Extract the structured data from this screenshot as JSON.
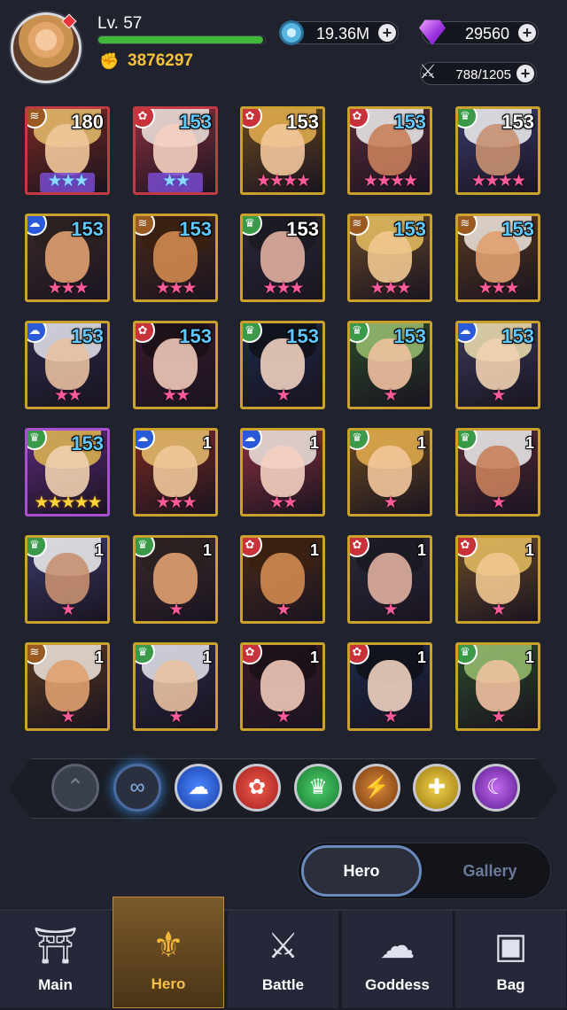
{
  "player": {
    "level_label": "Lv. 57",
    "power": "3876297",
    "xp_fraction": 0.99
  },
  "currency": {
    "coins": "19.36M",
    "gems": "29560",
    "hero_capacity": "788/1205"
  },
  "heroes": [
    {
      "level": "180",
      "stars": "★★★",
      "star_color": "blue",
      "faction": "bronze",
      "quality": "red"
    },
    {
      "level": "153",
      "stars": "★★",
      "star_color": "blue",
      "faction": "red",
      "quality": "red"
    },
    {
      "level": "153",
      "stars": "★★★★",
      "star_color": "pink",
      "faction": "red",
      "quality": "gold"
    },
    {
      "level": "153",
      "stars": "★★★★",
      "star_color": "pink",
      "faction": "red",
      "quality": "gold"
    },
    {
      "level": "153",
      "stars": "★★★★",
      "star_color": "pink",
      "faction": "nature",
      "quality": "gold"
    },
    {
      "level": "153",
      "stars": "★★★",
      "star_color": "pink",
      "faction": "blue",
      "quality": "gold"
    },
    {
      "level": "153",
      "stars": "★★★",
      "star_color": "pink",
      "faction": "bronze",
      "quality": "gold"
    },
    {
      "level": "153",
      "stars": "★★★",
      "star_color": "pink",
      "faction": "nature",
      "quality": "gold"
    },
    {
      "level": "153",
      "stars": "★★★",
      "star_color": "pink",
      "faction": "bronze",
      "quality": "gold"
    },
    {
      "level": "153",
      "stars": "★★★",
      "star_color": "pink",
      "faction": "bronze",
      "quality": "gold"
    },
    {
      "level": "153",
      "stars": "★★",
      "star_color": "pink",
      "faction": "blue",
      "quality": "gold"
    },
    {
      "level": "153",
      "stars": "★★",
      "star_color": "pink",
      "faction": "red",
      "quality": "gold"
    },
    {
      "level": "153",
      "stars": "★",
      "star_color": "pink",
      "faction": "nature",
      "quality": "gold"
    },
    {
      "level": "153",
      "stars": "★",
      "star_color": "pink",
      "faction": "nature",
      "quality": "gold"
    },
    {
      "level": "153",
      "stars": "★",
      "star_color": "pink",
      "faction": "blue",
      "quality": "gold"
    },
    {
      "level": "153",
      "stars": "★★★★★",
      "star_color": "gold",
      "faction": "nature",
      "quality": "purple"
    },
    {
      "level": "1",
      "stars": "★★★",
      "star_color": "pink",
      "faction": "blue",
      "quality": "gold"
    },
    {
      "level": "1",
      "stars": "★★",
      "star_color": "pink",
      "faction": "blue",
      "quality": "gold"
    },
    {
      "level": "1",
      "stars": "★",
      "star_color": "pink",
      "faction": "nature",
      "quality": "gold"
    },
    {
      "level": "1",
      "stars": "★",
      "star_color": "pink",
      "faction": "nature",
      "quality": "gold"
    },
    {
      "level": "1",
      "stars": "★",
      "star_color": "pink",
      "faction": "nature",
      "quality": "gold"
    },
    {
      "level": "1",
      "stars": "★",
      "star_color": "pink",
      "faction": "nature",
      "quality": "gold"
    },
    {
      "level": "1",
      "stars": "★",
      "star_color": "pink",
      "faction": "red",
      "quality": "gold"
    },
    {
      "level": "1",
      "stars": "★",
      "star_color": "pink",
      "faction": "red",
      "quality": "gold"
    },
    {
      "level": "1",
      "stars": "★",
      "star_color": "pink",
      "faction": "red",
      "quality": "gold"
    },
    {
      "level": "1",
      "stars": "★",
      "star_color": "pink",
      "faction": "bronze",
      "quality": "gold"
    },
    {
      "level": "1",
      "stars": "★",
      "star_color": "pink",
      "faction": "nature",
      "quality": "gold"
    },
    {
      "level": "1",
      "stars": "★",
      "star_color": "pink",
      "faction": "red",
      "quality": "gold"
    },
    {
      "level": "1",
      "stars": "★",
      "star_color": "pink",
      "faction": "red",
      "quality": "gold"
    },
    {
      "level": "1",
      "stars": "★",
      "star_color": "pink",
      "faction": "nature",
      "quality": "gold"
    }
  ],
  "filters": [
    {
      "name": "collapse",
      "icon": "chevron-up-icon"
    },
    {
      "name": "all",
      "icon": "infinity-icon"
    },
    {
      "name": "cloud",
      "icon": "cloud-icon"
    },
    {
      "name": "flower",
      "icon": "flower-icon"
    },
    {
      "name": "crown",
      "icon": "crown-icon"
    },
    {
      "name": "claw",
      "icon": "claw-icon"
    },
    {
      "name": "light",
      "icon": "cross-light-icon"
    },
    {
      "name": "moon",
      "icon": "moon-icon"
    }
  ],
  "toggle": {
    "hero": "Hero",
    "gallery": "Gallery"
  },
  "nav": [
    {
      "label": "Main",
      "icon": "temple-icon"
    },
    {
      "label": "Hero",
      "icon": "helmet-icon"
    },
    {
      "label": "Battle",
      "icon": "swords-icon"
    },
    {
      "label": "Goddess",
      "icon": "goddess-icon"
    },
    {
      "label": "Bag",
      "icon": "backpack-icon"
    }
  ],
  "colors": {
    "accent_gold": "#f6c239",
    "bg": "#20232d",
    "xp_green": "#3fb83a"
  }
}
